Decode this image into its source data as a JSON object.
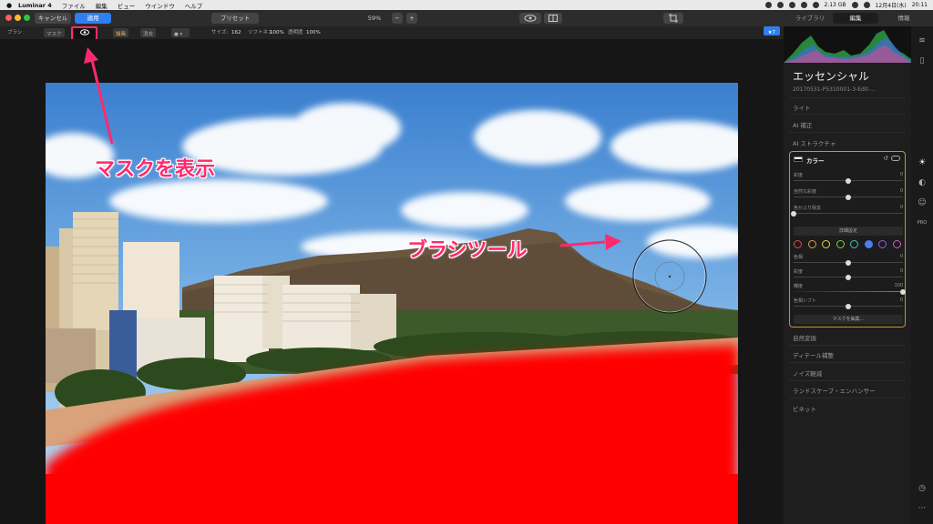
{
  "menubar": {
    "items": [
      "Luminar 4",
      "ファイル",
      "編集",
      "ビュー",
      "ウインドウ",
      "ヘルプ"
    ],
    "storage": "2.13 GB",
    "date": "12月4日(水)",
    "time": "20:11"
  },
  "toolbar": {
    "cancel_label": "キャンセル",
    "apply_label": "適用",
    "preset_label": "プリセット",
    "zoom": "59%",
    "zoom_minus": "−",
    "zoom_plus": "+",
    "tab_library": "ライブラリ",
    "tab_edit": "編集",
    "tab_info": "情報"
  },
  "brushbar": {
    "tool": "ブラシ",
    "mask_label": "マスク",
    "paint_label": "描画",
    "erase_label": "消去",
    "size_label": "サイズ:",
    "size_value": "162",
    "softness_label": "ソフトネス",
    "softness_value": "100%",
    "opacity_label": "透明度",
    "opacity_value": "100%",
    "star_label": "★7"
  },
  "annotations": {
    "mask": "マスクを表示",
    "brush": "ブラシツール"
  },
  "panel": {
    "title": "エッセンシャル",
    "filename": "20170531-P5310001-3-Edit-...",
    "items_top": [
      "ライト",
      "AI 補正",
      "AI ストラクチャ"
    ],
    "color_box": {
      "title": "カラー",
      "rows_top": [
        {
          "label": "彩度",
          "value": "0",
          "pos": 0.5
        },
        {
          "label": "自然な彩度",
          "value": "0",
          "pos": 0.5
        },
        {
          "label": "色かぶり除去",
          "value": "0",
          "pos": 0.0
        }
      ],
      "details_button": "詳細設定",
      "swatch_colors": [
        "#e24a4a",
        "#e89a3a",
        "#e6d34a",
        "#7fcf4a",
        "#3dc7b0",
        "#4a7ef0",
        "#9a5ce8",
        "#d65ac8"
      ],
      "selected_swatch": 5,
      "rows_bottom": [
        {
          "label": "色相",
          "value": "0",
          "pos": 0.5
        },
        {
          "label": "彩度",
          "value": "0",
          "pos": 0.5
        },
        {
          "label": "輝度",
          "value": "100",
          "pos": 1.0
        },
        {
          "label": "色相シフト",
          "value": "0",
          "pos": 0.5
        }
      ],
      "edit_mask_button": "マスクを編集..."
    },
    "items_bottom": [
      "自然変換",
      "ディテール補整",
      "ノイズ軽減",
      "ランドスケープ・エンハンサー",
      "ビネット"
    ]
  }
}
